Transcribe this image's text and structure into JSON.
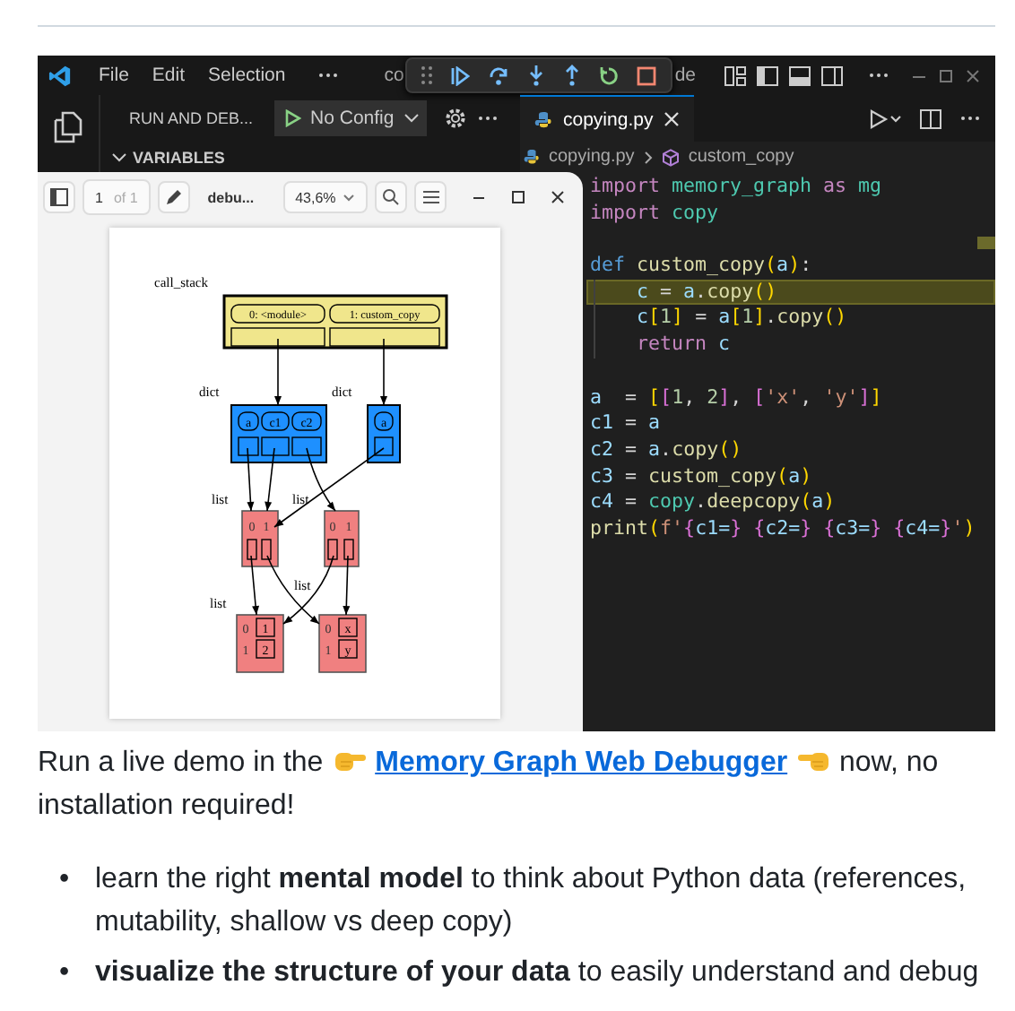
{
  "window": {
    "menu": [
      "File",
      "Edit",
      "Selection"
    ],
    "title_left": "co",
    "title_right": "de"
  },
  "sidebar": {
    "title": "RUN AND DEB...",
    "config": "No Config",
    "section": "VARIABLES",
    "expanded": true
  },
  "tabs": [
    {
      "label": "copying.py",
      "selected": true
    }
  ],
  "breadcrumbs": [
    "copying.py",
    "custom_copy"
  ],
  "pdf_viewer": {
    "page": "1",
    "page_count": "of 1",
    "file": "debu...",
    "zoom": "43,6%"
  },
  "diagram": {
    "title": "call_stack",
    "frames": [
      "0: <module>",
      "1: custom_copy"
    ],
    "dicts": [
      {
        "label": "dict",
        "keys": [
          "a",
          "c1",
          "c2"
        ]
      },
      {
        "label": "dict",
        "keys": [
          "a"
        ]
      }
    ],
    "lists": [
      {
        "label": "list",
        "indices": [
          "0",
          "1"
        ]
      },
      {
        "label": "list",
        "indices": [
          "0",
          "1"
        ]
      }
    ],
    "leaf_lists": [
      {
        "label": "list",
        "items": [
          {
            "index": "0",
            "value": "1"
          },
          {
            "index": "1",
            "value": "2"
          }
        ]
      },
      {
        "label": "list",
        "items": [
          {
            "index": "0",
            "value": "x"
          },
          {
            "index": "1",
            "value": "y"
          }
        ]
      }
    ]
  },
  "code": [
    {
      "kind": "code",
      "highlighted": false,
      "tokens": [
        {
          "kind": "kw",
          "text": "import"
        },
        {
          "kind": "mod",
          "text": " memory_graph"
        },
        {
          "kind": "kw",
          "text": " as"
        },
        {
          "kind": "mod",
          "text": " mg"
        }
      ]
    },
    {
      "kind": "code",
      "highlighted": false,
      "tokens": [
        {
          "kind": "kw",
          "text": "import"
        },
        {
          "kind": "mod",
          "text": " copy"
        }
      ]
    },
    {
      "kind": "blank"
    },
    {
      "kind": "code",
      "highlighted": false,
      "tokens": [
        {
          "kind": "def",
          "text": "def"
        },
        {
          "kind": "fn",
          "text": " custom_copy"
        },
        {
          "kind": "br1",
          "text": "("
        },
        {
          "kind": "var",
          "text": "a"
        },
        {
          "kind": "br1",
          "text": ")"
        },
        {
          "kind": "op",
          "text": ":"
        }
      ]
    },
    {
      "kind": "code",
      "highlighted": true,
      "tokens": [
        {
          "kind": "var",
          "text": "    c"
        },
        {
          "kind": "op",
          "text": " = "
        },
        {
          "kind": "var",
          "text": "a"
        },
        {
          "kind": "op",
          "text": "."
        },
        {
          "kind": "fn",
          "text": "copy"
        },
        {
          "kind": "br1",
          "text": "()"
        }
      ]
    },
    {
      "kind": "code",
      "highlighted": false,
      "tokens": [
        {
          "kind": "var",
          "text": "    c"
        },
        {
          "kind": "br1",
          "text": "["
        },
        {
          "kind": "num",
          "text": "1"
        },
        {
          "kind": "br1",
          "text": "]"
        },
        {
          "kind": "op",
          "text": " = "
        },
        {
          "kind": "var",
          "text": "a"
        },
        {
          "kind": "br1",
          "text": "["
        },
        {
          "kind": "num",
          "text": "1"
        },
        {
          "kind": "br1",
          "text": "]"
        },
        {
          "kind": "op",
          "text": "."
        },
        {
          "kind": "fn",
          "text": "copy"
        },
        {
          "kind": "br1",
          "text": "()"
        }
      ]
    },
    {
      "kind": "code",
      "highlighted": false,
      "tokens": [
        {
          "kind": "kw",
          "text": "    return"
        },
        {
          "kind": "var",
          "text": " c"
        }
      ]
    },
    {
      "kind": "blank"
    },
    {
      "kind": "code",
      "highlighted": false,
      "tokens": [
        {
          "kind": "var",
          "text": "a"
        },
        {
          "kind": "op",
          "text": "  = "
        },
        {
          "kind": "br1",
          "text": "["
        },
        {
          "kind": "br2",
          "text": "["
        },
        {
          "kind": "num",
          "text": "1"
        },
        {
          "kind": "op",
          "text": ", "
        },
        {
          "kind": "num",
          "text": "2"
        },
        {
          "kind": "br2",
          "text": "]"
        },
        {
          "kind": "op",
          "text": ", "
        },
        {
          "kind": "br2",
          "text": "["
        },
        {
          "kind": "str",
          "text": "'x'"
        },
        {
          "kind": "op",
          "text": ", "
        },
        {
          "kind": "str",
          "text": "'y'"
        },
        {
          "kind": "br2",
          "text": "]"
        },
        {
          "kind": "br1",
          "text": "]"
        }
      ]
    },
    {
      "kind": "code",
      "highlighted": false,
      "tokens": [
        {
          "kind": "var",
          "text": "c1"
        },
        {
          "kind": "op",
          "text": " = "
        },
        {
          "kind": "var",
          "text": "a"
        }
      ]
    },
    {
      "kind": "code",
      "highlighted": false,
      "tokens": [
        {
          "kind": "var",
          "text": "c2"
        },
        {
          "kind": "op",
          "text": " = "
        },
        {
          "kind": "var",
          "text": "a"
        },
        {
          "kind": "op",
          "text": "."
        },
        {
          "kind": "fn",
          "text": "copy"
        },
        {
          "kind": "br1",
          "text": "()"
        }
      ]
    },
    {
      "kind": "code",
      "highlighted": false,
      "tokens": [
        {
          "kind": "var",
          "text": "c3"
        },
        {
          "kind": "op",
          "text": " = "
        },
        {
          "kind": "fn",
          "text": "custom_copy"
        },
        {
          "kind": "br1",
          "text": "("
        },
        {
          "kind": "var",
          "text": "a"
        },
        {
          "kind": "br1",
          "text": ")"
        }
      ]
    },
    {
      "kind": "code",
      "highlighted": false,
      "tokens": [
        {
          "kind": "var",
          "text": "c4"
        },
        {
          "kind": "op",
          "text": " = "
        },
        {
          "kind": "mod",
          "text": "copy"
        },
        {
          "kind": "op",
          "text": "."
        },
        {
          "kind": "fn",
          "text": "deepcopy"
        },
        {
          "kind": "br1",
          "text": "("
        },
        {
          "kind": "var",
          "text": "a"
        },
        {
          "kind": "br1",
          "text": ")"
        }
      ]
    },
    {
      "kind": "code",
      "highlighted": false,
      "tokens": [
        {
          "kind": "fn",
          "text": "print"
        },
        {
          "kind": "br1",
          "text": "("
        },
        {
          "kind": "str",
          "text": "f'"
        },
        {
          "kind": "br2",
          "text": "{"
        },
        {
          "kind": "var",
          "text": "c1="
        },
        {
          "kind": "br2",
          "text": "} {"
        },
        {
          "kind": "var",
          "text": "c2="
        },
        {
          "kind": "br2",
          "text": "} {"
        },
        {
          "kind": "var",
          "text": "c3="
        },
        {
          "kind": "br2",
          "text": "} {"
        },
        {
          "kind": "var",
          "text": "c4="
        },
        {
          "kind": "br2",
          "text": "}"
        },
        {
          "kind": "str",
          "text": "'"
        },
        {
          "kind": "br1",
          "text": ")"
        }
      ]
    }
  ],
  "intro": {
    "before": "Run a live demo in the",
    "link": "Memory Graph Web Debugger",
    "after": "now, no installation required!"
  },
  "bullets": [
    {
      "marker": "•",
      "text": "learn the right **mental model** to think about Python data (references, mutability, shallow vs deep copy)"
    },
    {
      "marker": "•",
      "text": "**visualize the structure of your data** to easily understand and debug"
    }
  ]
}
